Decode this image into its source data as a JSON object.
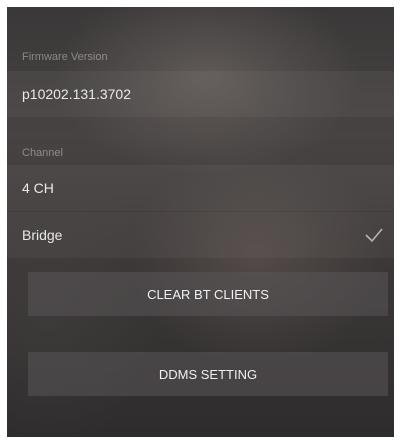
{
  "firmware": {
    "header": "Firmware Version",
    "value": "p10202.131.3702"
  },
  "channel": {
    "header": "Channel",
    "options": [
      {
        "label": "4 CH",
        "selected": false
      },
      {
        "label": "Bridge",
        "selected": true
      }
    ],
    "check_icon": "checkmark-icon"
  },
  "actions": {
    "clear_bt_clients": "CLEAR BT CLIENTS",
    "ddms_setting": "DDMS SETTING"
  },
  "colors": {
    "text_primary": "#e6e6e6",
    "text_secondary": "#9a9696",
    "button_bg": "#5a5658"
  }
}
